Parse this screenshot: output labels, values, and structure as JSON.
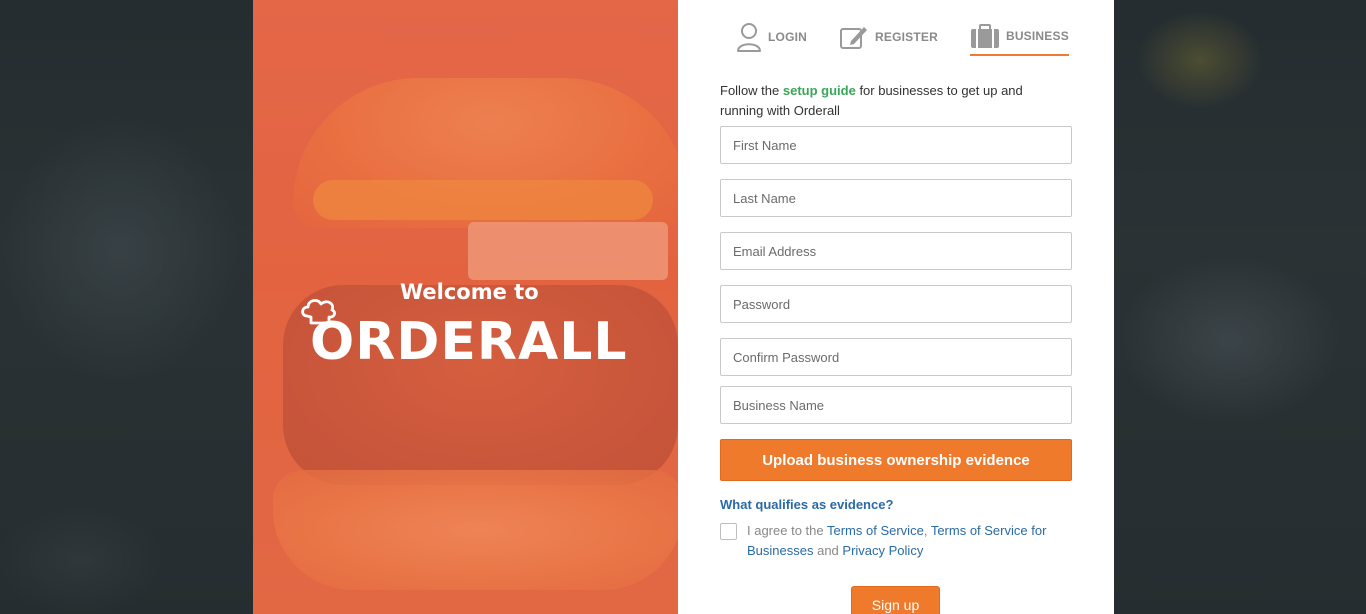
{
  "tabs": [
    {
      "label": "LOGIN",
      "icon": "user-icon"
    },
    {
      "label": "REGISTER",
      "icon": "edit-icon"
    },
    {
      "label": "BUSINESS",
      "icon": "briefcase-icon",
      "active": true
    }
  ],
  "hero": {
    "welcome": "Welcome to",
    "brand": "ORDERALL"
  },
  "intro": {
    "prefix": "Follow the ",
    "link": "setup guide",
    "suffix": " for businesses to get up and running with Orderall"
  },
  "form": {
    "first_name_placeholder": "First Name",
    "last_name_placeholder": "Last Name",
    "email_placeholder": "Email Address",
    "password_placeholder": "Password",
    "confirm_password_placeholder": "Confirm Password",
    "business_name_placeholder": "Business Name",
    "upload_label": "Upload business ownership evidence",
    "evidence_link": "What qualifies as evidence?",
    "agree_prefix": "I agree to the ",
    "terms_link": "Terms of Service",
    "comma": ", ",
    "terms_business_link": "Terms of Service for Businesses",
    "and": " and ",
    "privacy_link": "Privacy Policy",
    "signup_label": "Sign up"
  },
  "colors": {
    "accent": "#f07a2c",
    "link": "#2a6aa6",
    "guide_link": "#3aa659"
  }
}
